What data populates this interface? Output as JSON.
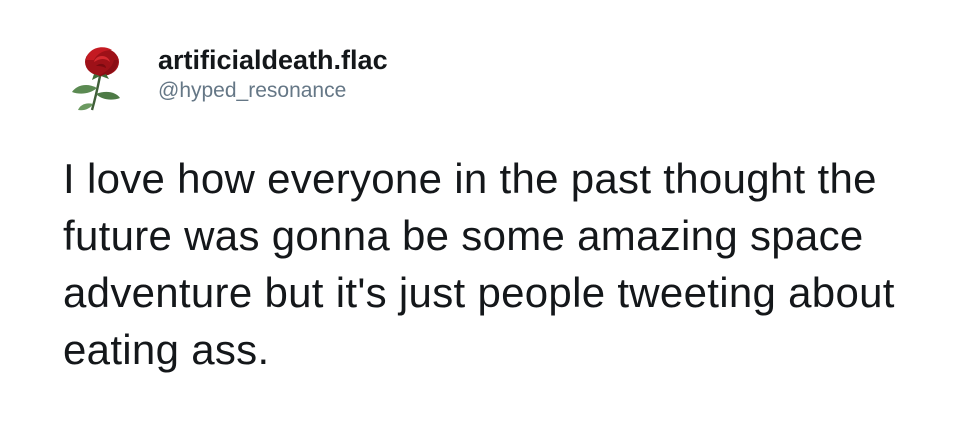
{
  "tweet": {
    "author": {
      "display_name": "artificialdeath.flac",
      "handle": "@hyped_resonance",
      "avatar_icon": "red-rose-icon"
    },
    "text": "I love how everyone in the past thought the future was gonna be some amazing space adventure but it's just people tweeting about eating ass."
  },
  "colors": {
    "name": "#14171a",
    "handle": "#657786",
    "body_text": "#14171a",
    "rose": "#b3141c",
    "leaf": "#4d7a46"
  }
}
